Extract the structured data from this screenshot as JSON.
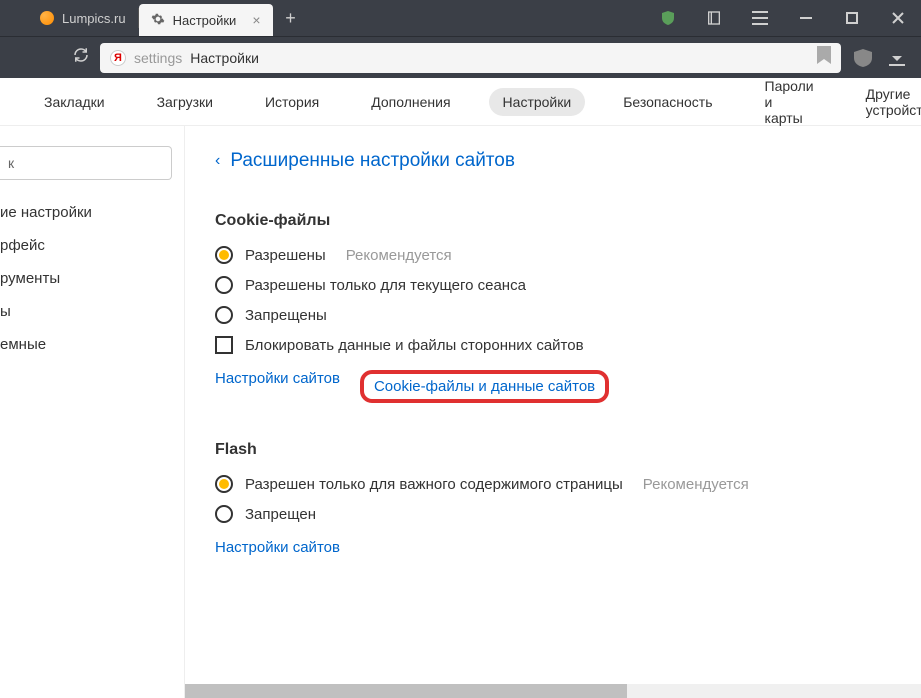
{
  "tabs": [
    {
      "title": "Lumpics.ru"
    },
    {
      "title": "Настройки"
    }
  ],
  "address": {
    "prefix": "settings",
    "text": "Настройки"
  },
  "nav": {
    "items": [
      "Закладки",
      "Загрузки",
      "История",
      "Дополнения",
      "Настройки",
      "Безопасность",
      "Пароли и карты",
      "Другие устройства"
    ],
    "active_index": 4
  },
  "sidebar": {
    "search_placeholder": "к",
    "items": [
      "ие настройки",
      "рфейс",
      "рументы",
      "ы",
      "емные"
    ]
  },
  "content": {
    "back_link": "Расширенные настройки сайтов",
    "sections": [
      {
        "title": "Cookie-файлы",
        "options": [
          {
            "type": "radio",
            "label": "Разрешены",
            "checked": true,
            "rec": "Рекомендуется"
          },
          {
            "type": "radio",
            "label": "Разрешены только для текущего сеанса",
            "checked": false
          },
          {
            "type": "radio",
            "label": "Запрещены",
            "checked": false
          },
          {
            "type": "checkbox",
            "label": "Блокировать данные и файлы сторонних сайтов",
            "checked": false
          }
        ],
        "links": [
          {
            "text": "Настройки сайтов",
            "highlight": false
          },
          {
            "text": "Cookie-файлы и данные сайтов",
            "highlight": true
          }
        ]
      },
      {
        "title": "Flash",
        "options": [
          {
            "type": "radio",
            "label": "Разрешен только для важного содержимого страницы",
            "checked": true,
            "rec": "Рекомендуется"
          },
          {
            "type": "radio",
            "label": "Запрещен",
            "checked": false
          }
        ],
        "links": [
          {
            "text": "Настройки сайтов",
            "highlight": false
          }
        ]
      }
    ]
  }
}
